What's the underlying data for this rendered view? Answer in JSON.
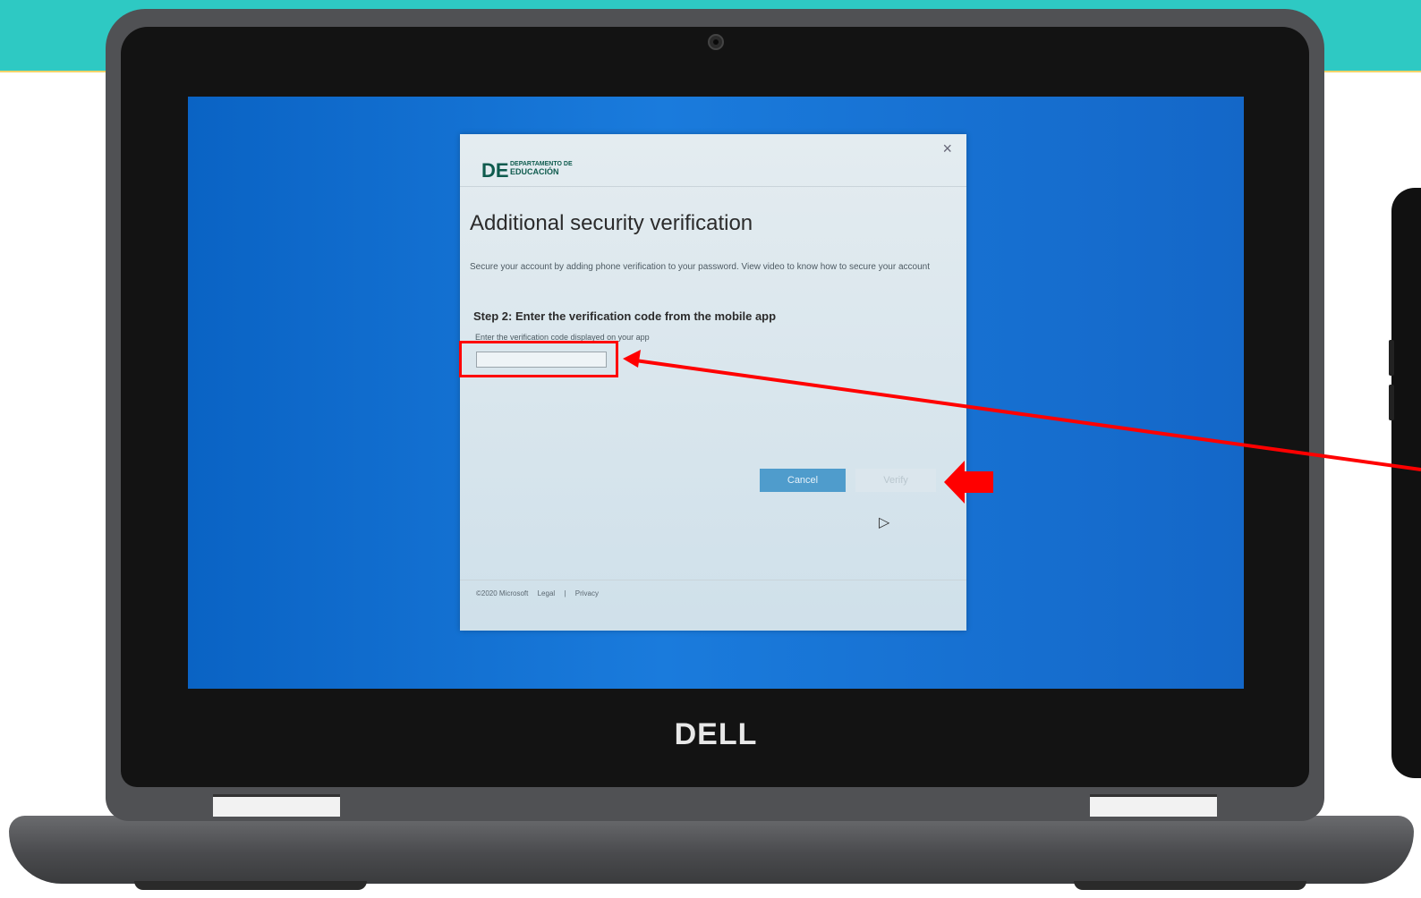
{
  "dialog": {
    "close_glyph": "×",
    "logo_mark": "DE",
    "logo_name_line1": "DEPARTAMENTO DE",
    "logo_name_line2": "EDUCACIÓN",
    "title": "Additional security verification",
    "description": "Secure your account by adding phone verification to your password. View video to know how to secure your account",
    "step_heading": "Step 2: Enter the verification code from the mobile app",
    "code_hint": "Enter the verification code displayed on your app",
    "code_value": "",
    "cancel_label": "Cancel",
    "verify_label": "Verify",
    "footer": {
      "copyright": "©2020 Microsoft",
      "legal": "Legal",
      "separator": "|",
      "privacy": "Privacy"
    }
  },
  "device": {
    "brand": "DELL"
  },
  "colors": {
    "banner": "#2ec9c3",
    "desktop": "#1a7bdc",
    "annotation": "#ff0000",
    "cancel_button": "#4f9ccc"
  }
}
